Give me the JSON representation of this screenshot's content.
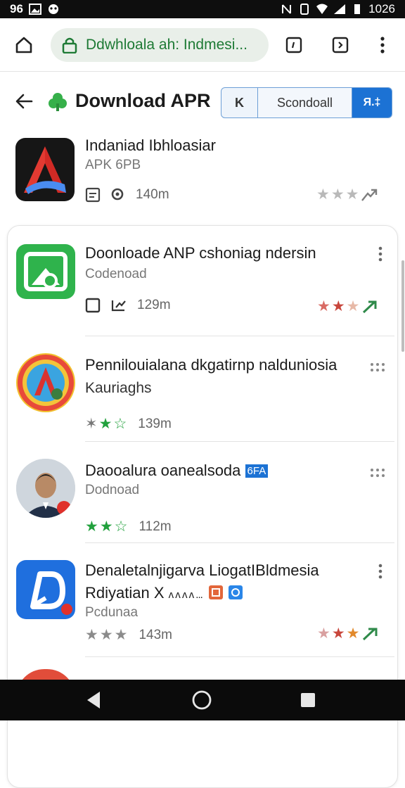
{
  "status_bar": {
    "time": "96",
    "battery": "1026"
  },
  "browser": {
    "url": "Ddwhloala ah: Indmesi...",
    "icons": [
      "home-icon",
      "lock-icon",
      "tabs-icon",
      "share-icon",
      "more-vert-icon"
    ]
  },
  "header": {
    "title": "Download APR",
    "segments": [
      "K",
      "Scondoall",
      "Я.‡"
    ]
  },
  "apps": [
    {
      "title": "Indaniad Ibhloasiar",
      "subtitle": "APK 6PB",
      "size": "140m",
      "rating_stars": 3,
      "icon": "letter-a-icon"
    },
    {
      "title": "Doonloade ANP cshoniag ndersin",
      "subtitle": "Codenoad",
      "size": "129m",
      "rating_stars": 3,
      "icon": "green-frame-icon"
    },
    {
      "title": "Pennilouialana dkgatirnp nalduniosia",
      "subtitle": "Kauriaghs",
      "size": "139m",
      "rating_stars": 3,
      "icon": "rainbow-a-icon"
    },
    {
      "title": "Daooalura oanealsoda",
      "badge": "6FA",
      "subtitle": "Dodnoad",
      "size": "112m",
      "rating_stars": 3,
      "icon": "person-avatar-icon"
    },
    {
      "title": "Denaletalnjigarva LiogatIBldmesia",
      "line2": "Rdiyatian X",
      "line2_tail": "ʌ ʌ ʌ ʌ ...",
      "subtitle": "Pcdunaa",
      "size": "143m",
      "rating_stars": 3,
      "icon": "blue-d-icon"
    }
  ],
  "colors": {
    "accent": "#1c72d4",
    "url_green": "#1e7a35",
    "star_green": "#22a13d",
    "star_grey": "#8b8b8b",
    "star_red": "#c8463c",
    "star_orange": "#e2892b"
  }
}
